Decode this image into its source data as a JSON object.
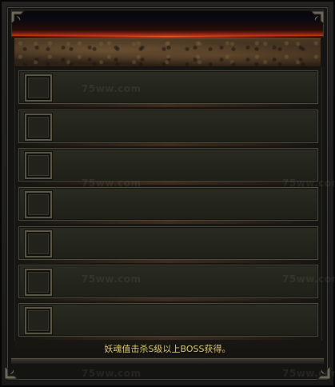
{
  "panel": {
    "slot_count": 7,
    "hint_text": "妖魂值击杀S级以上BOSS获得。",
    "colors": {
      "title_glow": "#c23a12",
      "hint_text": "#f0d97a",
      "row_border": "#4f4c3f",
      "row_fill": "#24251c"
    }
  },
  "watermark": {
    "text": "75ww.com"
  }
}
